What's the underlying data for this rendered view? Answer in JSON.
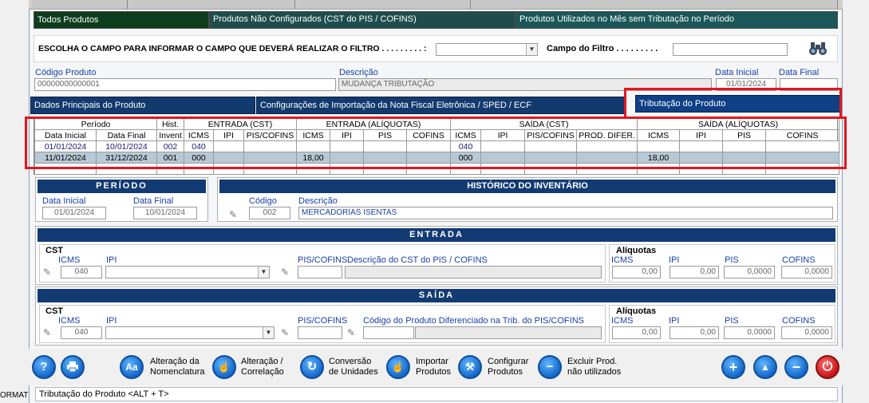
{
  "top_tabs": [
    "Todos Produtos",
    "Produtos Não Configurados (CST do PIS / COFINS)",
    "Produtos Utilizados no Mês sem Tributação no Período"
  ],
  "filter": {
    "label": "ESCOLHA O CAMPO PARA INFORMAR O CAMPO QUE DEVERÁ REALIZAR O FILTRO . . . . . . . . . :",
    "field_label": "Campo do Filtro . . . . . . . . .",
    "select_value": "",
    "field_value": ""
  },
  "product": {
    "code_label": "Código Produto",
    "code_value": "00000000000001",
    "desc_label": "Descrição",
    "desc_value": "MUDANÇA TRIBUTAÇÃO",
    "date_start_label": "Data Inicial",
    "date_start_value": "01/01/2024",
    "date_end_label": "Data Final",
    "date_end_value": ""
  },
  "tabs": [
    "Dados Principais do Produto",
    "Configurações de Importação da Nota Fiscal Eletrônica / SPED / ECF",
    "Tributação do Produto"
  ],
  "grid": {
    "group_headers": [
      "Período",
      "Hist.",
      "ENTRADA (CST)",
      "ENTRADA (ALÍQUOTAS)",
      "SAÍDA (CST)",
      "SAÍDA (ALÍQUOTAS)"
    ],
    "columns": [
      "Data Inicial",
      "Data Final",
      "Invent",
      "ICMS",
      "IPI",
      "PIS/COFINS",
      "ICMS",
      "IPI",
      "PIS",
      "COFINS",
      "ICMS",
      "IPI",
      "PIS/COFINS",
      "PROD. DIFER.",
      "ICMS",
      "IPI",
      "PIS",
      "COFINS"
    ],
    "rows": [
      [
        "01/01/2024",
        "10/01/2024",
        "002",
        "040",
        "",
        "",
        "",
        "",
        "",
        "",
        "040",
        "",
        "",
        "",
        "",
        "",
        "",
        ""
      ],
      [
        "11/01/2024",
        "31/12/2024",
        "001",
        "000",
        "",
        "",
        "18,00",
        "",
        "",
        "",
        "000",
        "",
        "",
        "",
        "18,00",
        "",
        "",
        ""
      ]
    ]
  },
  "periodo": {
    "title": "PERÍODO",
    "start_label": "Data Inicial",
    "start_value": "01/01/2024",
    "end_label": "Data Final",
    "end_value": "10/01/2024"
  },
  "historico": {
    "title": "HISTÓRICO DO INVENTÁRIO",
    "code_label": "Código",
    "code_value": "002",
    "desc_label": "Descrição",
    "desc_value": "MERCADORIAS ISENTAS"
  },
  "entrada": {
    "title": "ENTRADA",
    "cst_label": "CST",
    "icms_label": "ICMS",
    "icms_value": "040",
    "ipi_label": "IPI",
    "ipi_value": "",
    "pis_label": "PIS/COFINS",
    "pis_desc_label": "Descrição do CST do PIS / COFINS",
    "pis_value": "",
    "aliq_label": "Alíquotas",
    "aliq_icms_label": "ICMS",
    "aliq_ipi_label": "IPI",
    "aliq_pis_label": "PIS",
    "aliq_cofins_label": "COFINS",
    "aliq_icms": "0,00",
    "aliq_ipi": "0,00",
    "aliq_pis": "0,0000",
    "aliq_cofins": "0,0000"
  },
  "saida": {
    "title": "SAÍDA",
    "cst_label": "CST",
    "icms_label": "ICMS",
    "icms_value": "040",
    "ipi_label": "IPI",
    "ipi_value": "",
    "pis_label": "PIS/COFINS",
    "prod_label": "Código do Produto Diferenciado na Trib. do PIS/COFINS",
    "pis_value": "",
    "aliq_label": "Alíquotas",
    "aliq_icms_label": "ICMS",
    "aliq_ipi_label": "IPI",
    "aliq_pis_label": "PIS",
    "aliq_cofins_label": "COFINS",
    "aliq_icms": "0,00",
    "aliq_ipi": "0,00",
    "aliq_pis": "0,0000",
    "aliq_cofins": "0,0000"
  },
  "toolbar": {
    "help_icon": "?",
    "print_icon": "printer",
    "nomen_line1": "Alteração da",
    "nomen_line2": "Nomenclatura",
    "nomen_icon": "Aa",
    "corr_line1": "Alteração /",
    "corr_line2": "Correlação",
    "conv_line1": "Conversão",
    "conv_line2": "de Unidades",
    "imp_line1": "Importar",
    "imp_line2": "Produtos",
    "conf_line1": "Configurar",
    "conf_line2": "Produtos",
    "exc_line1": "Excluir Prod.",
    "exc_line2": "não utilizados",
    "add_icon": "+",
    "up_icon": "▲",
    "minus_icon": "−",
    "power_icon": "⏻"
  },
  "status": "Tributação do Produto  <ALT + T>",
  "left_status": "ORMAT"
}
